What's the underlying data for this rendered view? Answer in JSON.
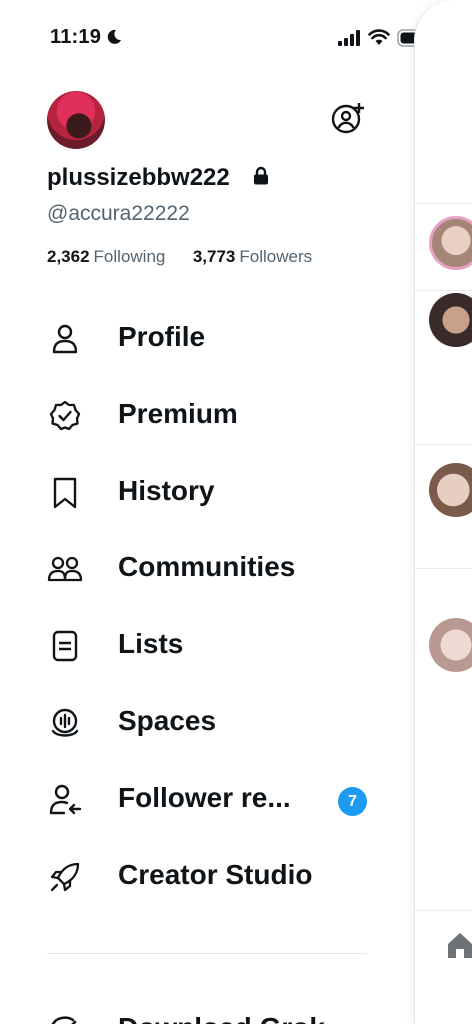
{
  "status_bar": {
    "time": "11:19"
  },
  "profile": {
    "display_name": "plussizebbw222",
    "handle": "@accura22222",
    "following_count": "2,362",
    "following_label": "Following",
    "followers_count": "3,773",
    "followers_label": "Followers"
  },
  "menu": {
    "items": [
      {
        "label": "Profile",
        "icon": "person-icon"
      },
      {
        "label": "Premium",
        "icon": "verified-badge-icon"
      },
      {
        "label": "History",
        "icon": "bookmark-icon"
      },
      {
        "label": "Communities",
        "icon": "communities-icon"
      },
      {
        "label": "Lists",
        "icon": "list-icon"
      },
      {
        "label": "Spaces",
        "icon": "microphone-icon"
      },
      {
        "label": "Follower re...",
        "icon": "follower-requests-icon",
        "badge": "7"
      },
      {
        "label": "Creator Studio",
        "icon": "rocket-icon"
      }
    ],
    "cutoff_label": "Download Grok"
  },
  "colors": {
    "accent": "#1d9bf0",
    "secondary_text": "#536471",
    "primary_text": "#0f1419"
  }
}
